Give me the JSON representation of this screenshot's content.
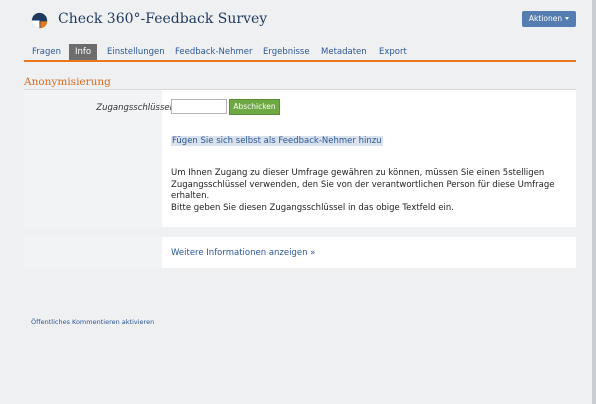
{
  "header": {
    "title": "Check 360°-Feedback Survey",
    "actions_label": "Aktionen"
  },
  "tabs": [
    {
      "label": "Fragen"
    },
    {
      "label": "Info",
      "active": true
    },
    {
      "label": "Einstellungen"
    },
    {
      "label": "Feedback-Nehmer"
    },
    {
      "label": "Ergebnisse"
    },
    {
      "label": "Metadaten"
    },
    {
      "label": "Export"
    }
  ],
  "section": {
    "title": "Anonymisierung"
  },
  "form": {
    "access_key_label": "Zugangsschlüssel",
    "access_key_value": "",
    "submit_label": "Abschicken"
  },
  "join_link": "Fügen Sie sich selbst als Feedback-Nehmer hinzu",
  "info_text": {
    "line1": "Um Ihnen Zugang zu dieser Umfrage gewähren zu können, müssen Sie einen 5stelligen Zugangsschlüssel verwenden, den Sie von der verantwortlichen Person für diese Umfrage erhalten.",
    "line2": "Bitte geben Sie diesen Zugangsschlüssel in das obige Textfeld ein."
  },
  "more_info": "Weitere Informationen anzeigen »",
  "comment_link": "Öffentliches Kommentieren aktivieren",
  "colors": {
    "accent": "#e8781f",
    "link": "#2b5797",
    "button_primary": "#6ea843",
    "actions_button": "#557db1",
    "active_tab": "#6d6d6d"
  }
}
